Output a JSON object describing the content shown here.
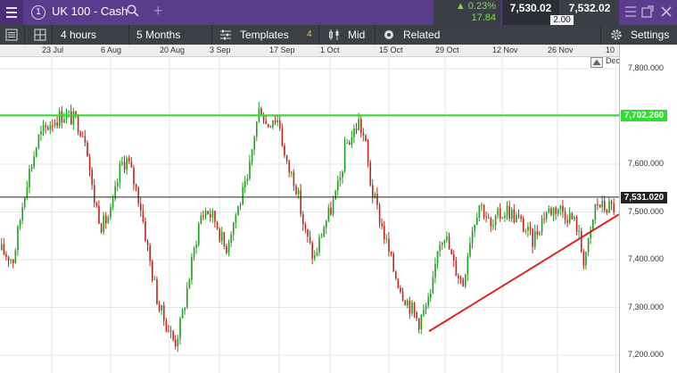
{
  "header": {
    "instrument_number": "1",
    "instrument_name": "UK 100 - Cash",
    "change_pct": "▲ 0.23%",
    "change_abs": "17.84",
    "sell_price": "7,530.02",
    "buy_price": "7,532.02",
    "spread": "2.00"
  },
  "toolbar": {
    "interval": "4 hours",
    "range": "5 Months",
    "templates": "Templates",
    "templates_count": "4",
    "price_type": "Mid",
    "related": "Related",
    "settings": "Settings"
  },
  "chart_data": {
    "type": "candlestick",
    "instrument": "UK 100 - Cash",
    "x_tick_labels": [
      "23 Jul",
      "6 Aug",
      "20 Aug",
      "3 Sep",
      "17 Sep",
      "1 Oct",
      "15 Oct",
      "29 Oct",
      "12 Nov",
      "26 Nov",
      "10 Dec"
    ],
    "y_tick_labels": [
      "7,800.000",
      "7,700.000",
      "7,600.000",
      "7,500.000",
      "7,400.000",
      "7,300.000",
      "7,200.000"
    ],
    "ylim": [
      7180,
      7830
    ],
    "grid": true,
    "up_color": "#1ea01e",
    "down_color": "#c0281e",
    "path": [
      [
        0,
        7420
      ],
      [
        4,
        7400
      ],
      [
        8,
        7560
      ],
      [
        12,
        7655
      ],
      [
        16,
        7690
      ],
      [
        20,
        7705
      ],
      [
        24,
        7690
      ],
      [
        27,
        7655
      ],
      [
        29,
        7540
      ],
      [
        32,
        7470
      ],
      [
        35,
        7500
      ],
      [
        38,
        7600
      ],
      [
        40,
        7610
      ],
      [
        44,
        7520
      ],
      [
        47,
        7400
      ],
      [
        50,
        7300
      ],
      [
        53,
        7255
      ],
      [
        55,
        7225
      ],
      [
        57,
        7270
      ],
      [
        60,
        7380
      ],
      [
        63,
        7490
      ],
      [
        65,
        7505
      ],
      [
        68,
        7480
      ],
      [
        71,
        7420
      ],
      [
        73,
        7470
      ],
      [
        76,
        7530
      ],
      [
        78,
        7560
      ],
      [
        80,
        7660
      ],
      [
        82,
        7725
      ],
      [
        84,
        7680
      ],
      [
        86,
        7700
      ],
      [
        88,
        7690
      ],
      [
        90,
        7600
      ],
      [
        93,
        7565
      ],
      [
        96,
        7460
      ],
      [
        99,
        7400
      ],
      [
        102,
        7470
      ],
      [
        104,
        7500
      ],
      [
        107,
        7560
      ],
      [
        109,
        7640
      ],
      [
        111,
        7660
      ],
      [
        113,
        7690
      ],
      [
        115,
        7650
      ],
      [
        117,
        7550
      ],
      [
        120,
        7480
      ],
      [
        124,
        7380
      ],
      [
        127,
        7330
      ],
      [
        130,
        7295
      ],
      [
        132,
        7270
      ],
      [
        134,
        7295
      ],
      [
        136,
        7320
      ],
      [
        138,
        7430
      ],
      [
        140,
        7460
      ],
      [
        143,
        7390
      ],
      [
        146,
        7350
      ],
      [
        148,
        7440
      ],
      [
        151,
        7520
      ],
      [
        153,
        7500
      ],
      [
        155,
        7460
      ],
      [
        157,
        7490
      ],
      [
        160,
        7505
      ],
      [
        164,
        7480
      ],
      [
        168,
        7440
      ],
      [
        172,
        7500
      ],
      [
        176,
        7510
      ],
      [
        180,
        7490
      ],
      [
        182,
        7470
      ],
      [
        184,
        7400
      ],
      [
        186,
        7440
      ],
      [
        188,
        7520
      ],
      [
        190,
        7510
      ]
    ],
    "horizontal_lines": [
      {
        "price": 7702.26,
        "color": "#2ee02e",
        "label": "7,702.260"
      },
      {
        "price": 7531.02,
        "color": "#222222",
        "label": "7,531.020"
      }
    ],
    "trendline": {
      "from": [
        "29 Oct",
        7250
      ],
      "to": [
        "10 Dec",
        7495
      ],
      "color": "#e02020"
    }
  }
}
